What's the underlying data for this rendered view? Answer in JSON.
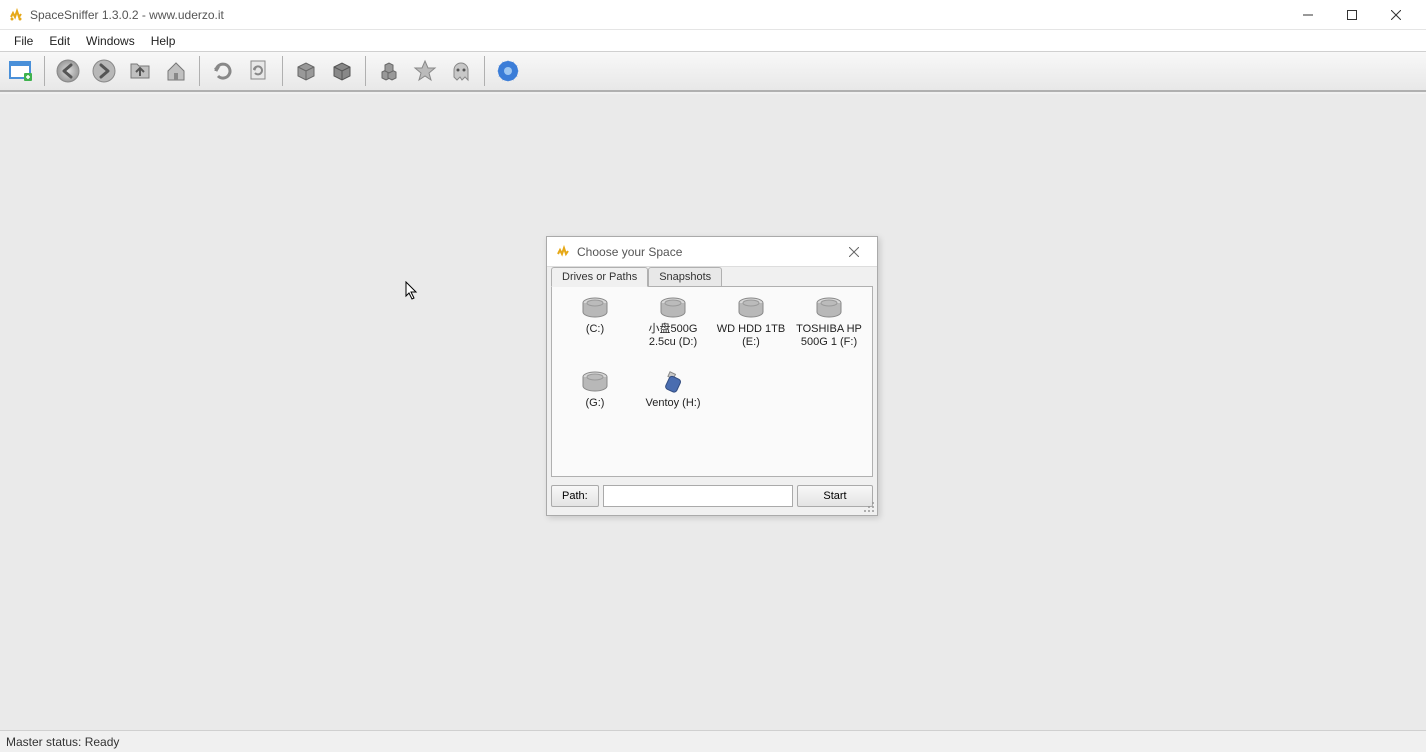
{
  "window": {
    "title": "SpaceSniffer 1.3.0.2 - www.uderzo.it"
  },
  "menubar": {
    "items": [
      "File",
      "Edit",
      "Windows",
      "Help"
    ]
  },
  "toolbar": {
    "buttons": [
      {
        "name": "new-scan-icon"
      },
      {
        "name": "back-icon"
      },
      {
        "name": "forward-icon"
      },
      {
        "name": "up-icon"
      },
      {
        "name": "home-icon"
      },
      {
        "name": "refresh-icon"
      },
      {
        "name": "reload-icon"
      },
      {
        "name": "box-icon"
      },
      {
        "name": "box-alt-icon"
      },
      {
        "name": "boxes-icon"
      },
      {
        "name": "star-icon"
      },
      {
        "name": "ghost-icon"
      },
      {
        "name": "gear-icon"
      }
    ]
  },
  "dialog": {
    "title": "Choose your Space",
    "tabs": {
      "drives": "Drives or Paths",
      "snapshots": "Snapshots"
    },
    "drives": [
      {
        "label": "(C:)",
        "type": "hdd"
      },
      {
        "label": "小盘500G 2.5cu (D:)",
        "type": "hdd"
      },
      {
        "label": "WD HDD 1TB (E:)",
        "type": "hdd"
      },
      {
        "label": "TOSHIBA HP 500G 1 (F:)",
        "type": "hdd"
      },
      {
        "label": "(G:)",
        "type": "hdd"
      },
      {
        "label": "Ventoy (H:)",
        "type": "usb"
      }
    ],
    "path_label": "Path:",
    "path_value": "",
    "start_label": "Start"
  },
  "status": {
    "text": "Master status: Ready"
  }
}
